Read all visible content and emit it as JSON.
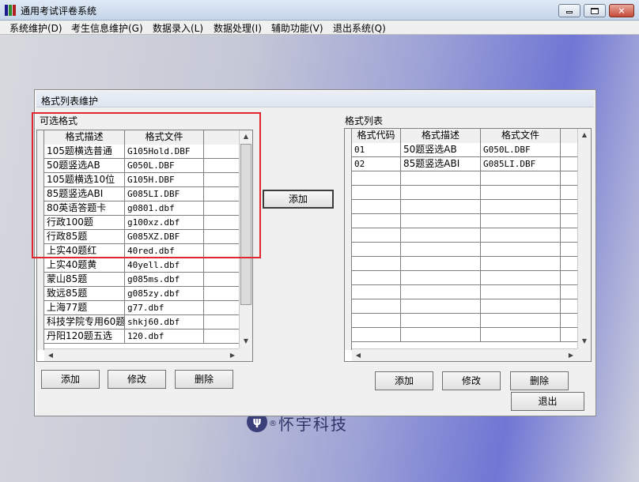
{
  "window": {
    "title": "通用考试评卷系统"
  },
  "menu": [
    "系统维护(D)",
    "考生信息维护(G)",
    "数据录入(L)",
    "数据处理(I)",
    "辅助功能(V)",
    "退出系统(Q)"
  ],
  "brand": {
    "logo_glyph": "ψ",
    "reg": "®",
    "text": "怀宇科技"
  },
  "dialog": {
    "title": "格式列表维护",
    "available": {
      "label": "可选格式",
      "columns": [
        "格式描述",
        "格式文件"
      ],
      "rows": [
        [
          "105题横选普通",
          "G105Hold.DBF"
        ],
        [
          "50题竖选AB",
          "G050L.DBF"
        ],
        [
          "105题横选10位",
          "G105H.DBF"
        ],
        [
          "85题竖选ABI",
          "G085LI.DBF"
        ],
        [
          "80英语答题卡",
          "g0801.dbf"
        ],
        [
          "行政100题",
          "g100xz.dbf"
        ],
        [
          "行政85题",
          "G085XZ.DBF"
        ],
        [
          "上实40题红",
          "40red.dbf"
        ],
        [
          "上实40题黄",
          "40yell.dbf"
        ],
        [
          "蒙山85题",
          "g085ms.dbf"
        ],
        [
          "致远85题",
          "g085zy.dbf"
        ],
        [
          "上海77题",
          "g77.dbf"
        ],
        [
          "科技学院专用60题",
          "shkj60.dbf"
        ],
        [
          "丹阳120题五选",
          "120.dbf"
        ]
      ],
      "buttons": {
        "add": "添加",
        "edit": "修改",
        "delete": "删除"
      }
    },
    "transfer_button": "添加",
    "format_list": {
      "label": "格式列表",
      "columns": [
        "格式代码",
        "格式描述",
        "格式文件"
      ],
      "rows": [
        [
          "01",
          "50题竖选AB",
          "G050L.DBF"
        ],
        [
          "02",
          "85题竖选ABI",
          "G085LI.DBF"
        ]
      ],
      "buttons": {
        "add": "添加",
        "edit": "修改",
        "delete": "删除",
        "exit": "退出"
      }
    }
  },
  "colors": {
    "highlight": "#e0262e"
  }
}
